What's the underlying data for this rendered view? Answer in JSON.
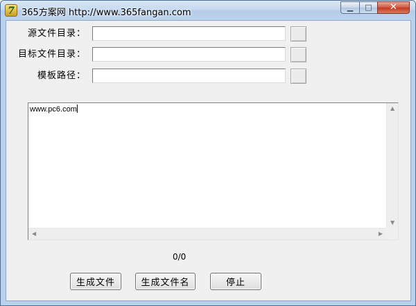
{
  "window": {
    "title": "365方案网 http://www.365fangan.com",
    "icon_glyph": "7",
    "controls": {
      "minimize_glyph": "▁",
      "maximize_glyph": "□",
      "close_glyph": "✕"
    }
  },
  "form": {
    "source_dir": {
      "label": "源文件目录：",
      "value": ""
    },
    "target_dir": {
      "label": "目标文件目录：",
      "value": ""
    },
    "template_path": {
      "label": "模板路径：",
      "value": ""
    }
  },
  "log": {
    "text": "www.pc6.com"
  },
  "progress": {
    "text": "0/0"
  },
  "buttons": {
    "generate_files": "生成文件",
    "generate_filenames": "生成文件名",
    "stop": "停止"
  },
  "icons": {
    "scroll_up": "▲",
    "scroll_down": "▼",
    "scroll_left": "◀",
    "scroll_right": "▶"
  }
}
